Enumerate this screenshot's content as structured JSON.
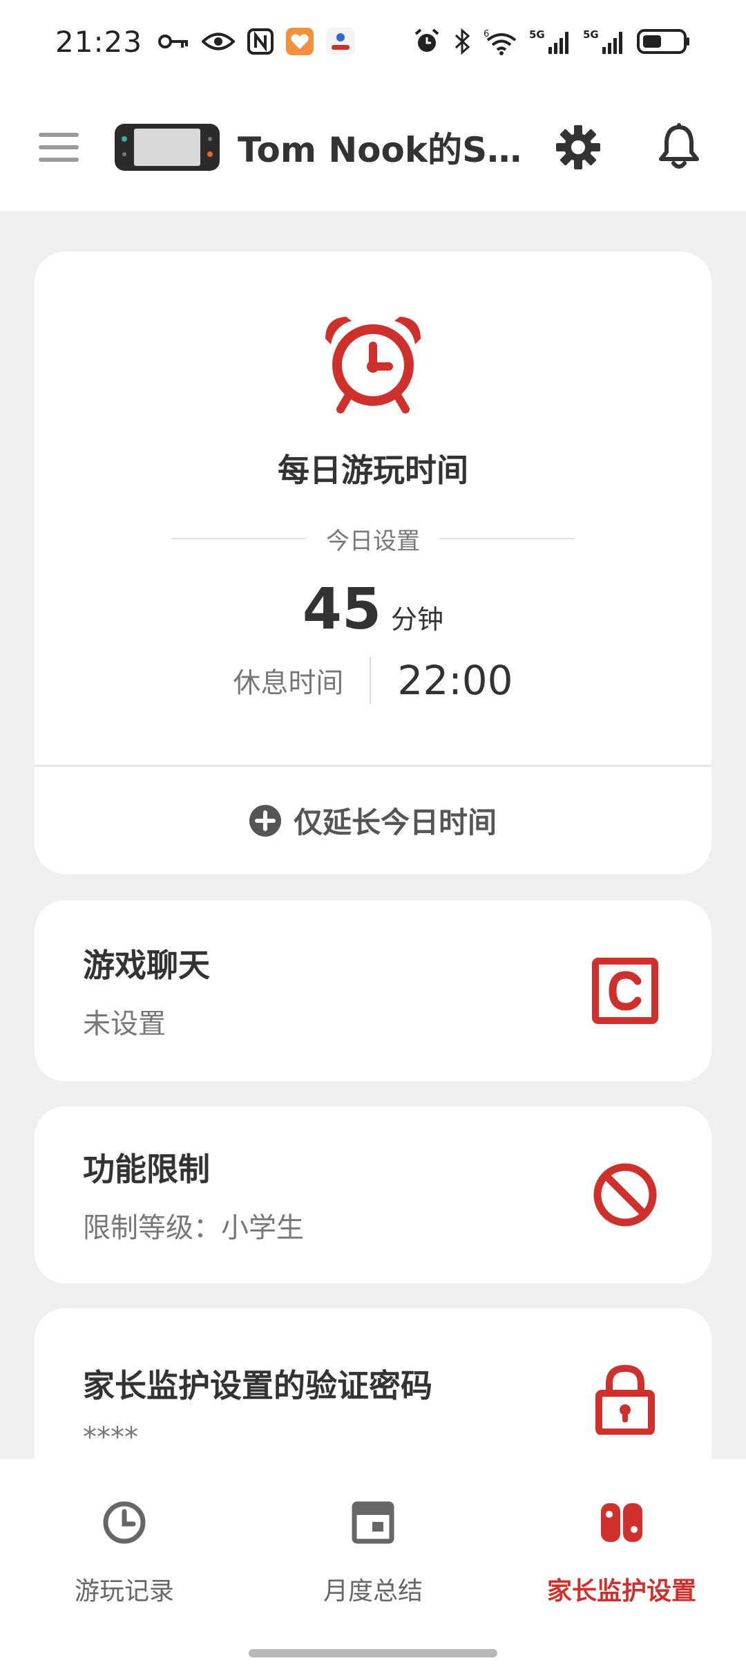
{
  "status_bar": {
    "time": "21:23",
    "network_5g_1": "5G",
    "network_5g_2": "5G",
    "wifi_badge": "6"
  },
  "header": {
    "title": "Tom  Nook的Switch"
  },
  "daily_play": {
    "title": "每日游玩时间",
    "today_label": "今日设置",
    "minutes_value": "45",
    "minutes_unit": "分钟",
    "rest_label": "休息时间",
    "rest_value": "22:00",
    "extend_label": "仅延长今日时间"
  },
  "game_chat": {
    "title": "游戏聊天",
    "subtitle": "未设置"
  },
  "function_limits": {
    "title": "功能限制",
    "subtitle": "限制等级：小学生"
  },
  "pin": {
    "title": "家长监护设置的验证密码",
    "subtitle": "****"
  },
  "bottom_nav": {
    "items": [
      {
        "label": "游玩记录",
        "icon": "clock-icon",
        "active": false
      },
      {
        "label": "月度总结",
        "icon": "calendar-icon",
        "active": false
      },
      {
        "label": "家长监护设置",
        "icon": "switch-console-icon",
        "active": true
      }
    ]
  },
  "colors": {
    "accent": "#d0302b",
    "text_primary": "#333333",
    "text_secondary": "#777777",
    "background": "#efefef",
    "card": "#ffffff"
  }
}
